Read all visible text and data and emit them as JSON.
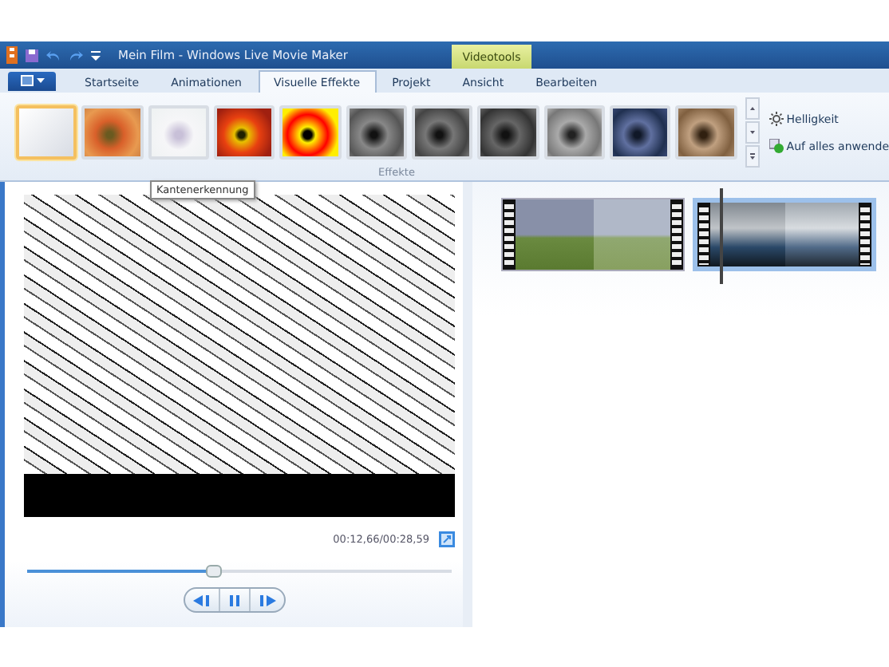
{
  "window": {
    "title": "Mein Film - Windows Live Movie Maker",
    "contextual_tab": "Videotools"
  },
  "tabs": [
    {
      "label": "Startseite",
      "selected": false
    },
    {
      "label": "Animationen",
      "selected": false
    },
    {
      "label": "Visuelle Effekte",
      "selected": true
    },
    {
      "label": "Projekt",
      "selected": false
    },
    {
      "label": "Ansicht",
      "selected": false
    },
    {
      "label": "Bearbeiten",
      "selected": false
    }
  ],
  "effects": [
    {
      "selected": true
    },
    {
      "selected": false
    },
    {
      "selected": false
    },
    {
      "selected": false
    },
    {
      "selected": false
    },
    {
      "selected": false
    },
    {
      "selected": false
    },
    {
      "selected": false
    },
    {
      "selected": false
    },
    {
      "selected": false
    },
    {
      "selected": false
    }
  ],
  "effects_commands": [
    "Helligkeit",
    "Auf alles anwende"
  ],
  "effects_group_label": "Effekte",
  "tooltip": "Kantenerkennung",
  "preview": {
    "time": "00:12,66/00:28,59",
    "level": 0.44
  },
  "storyboard": {
    "clips": [
      {
        "selected": false
      },
      {
        "selected": true
      }
    ]
  }
}
